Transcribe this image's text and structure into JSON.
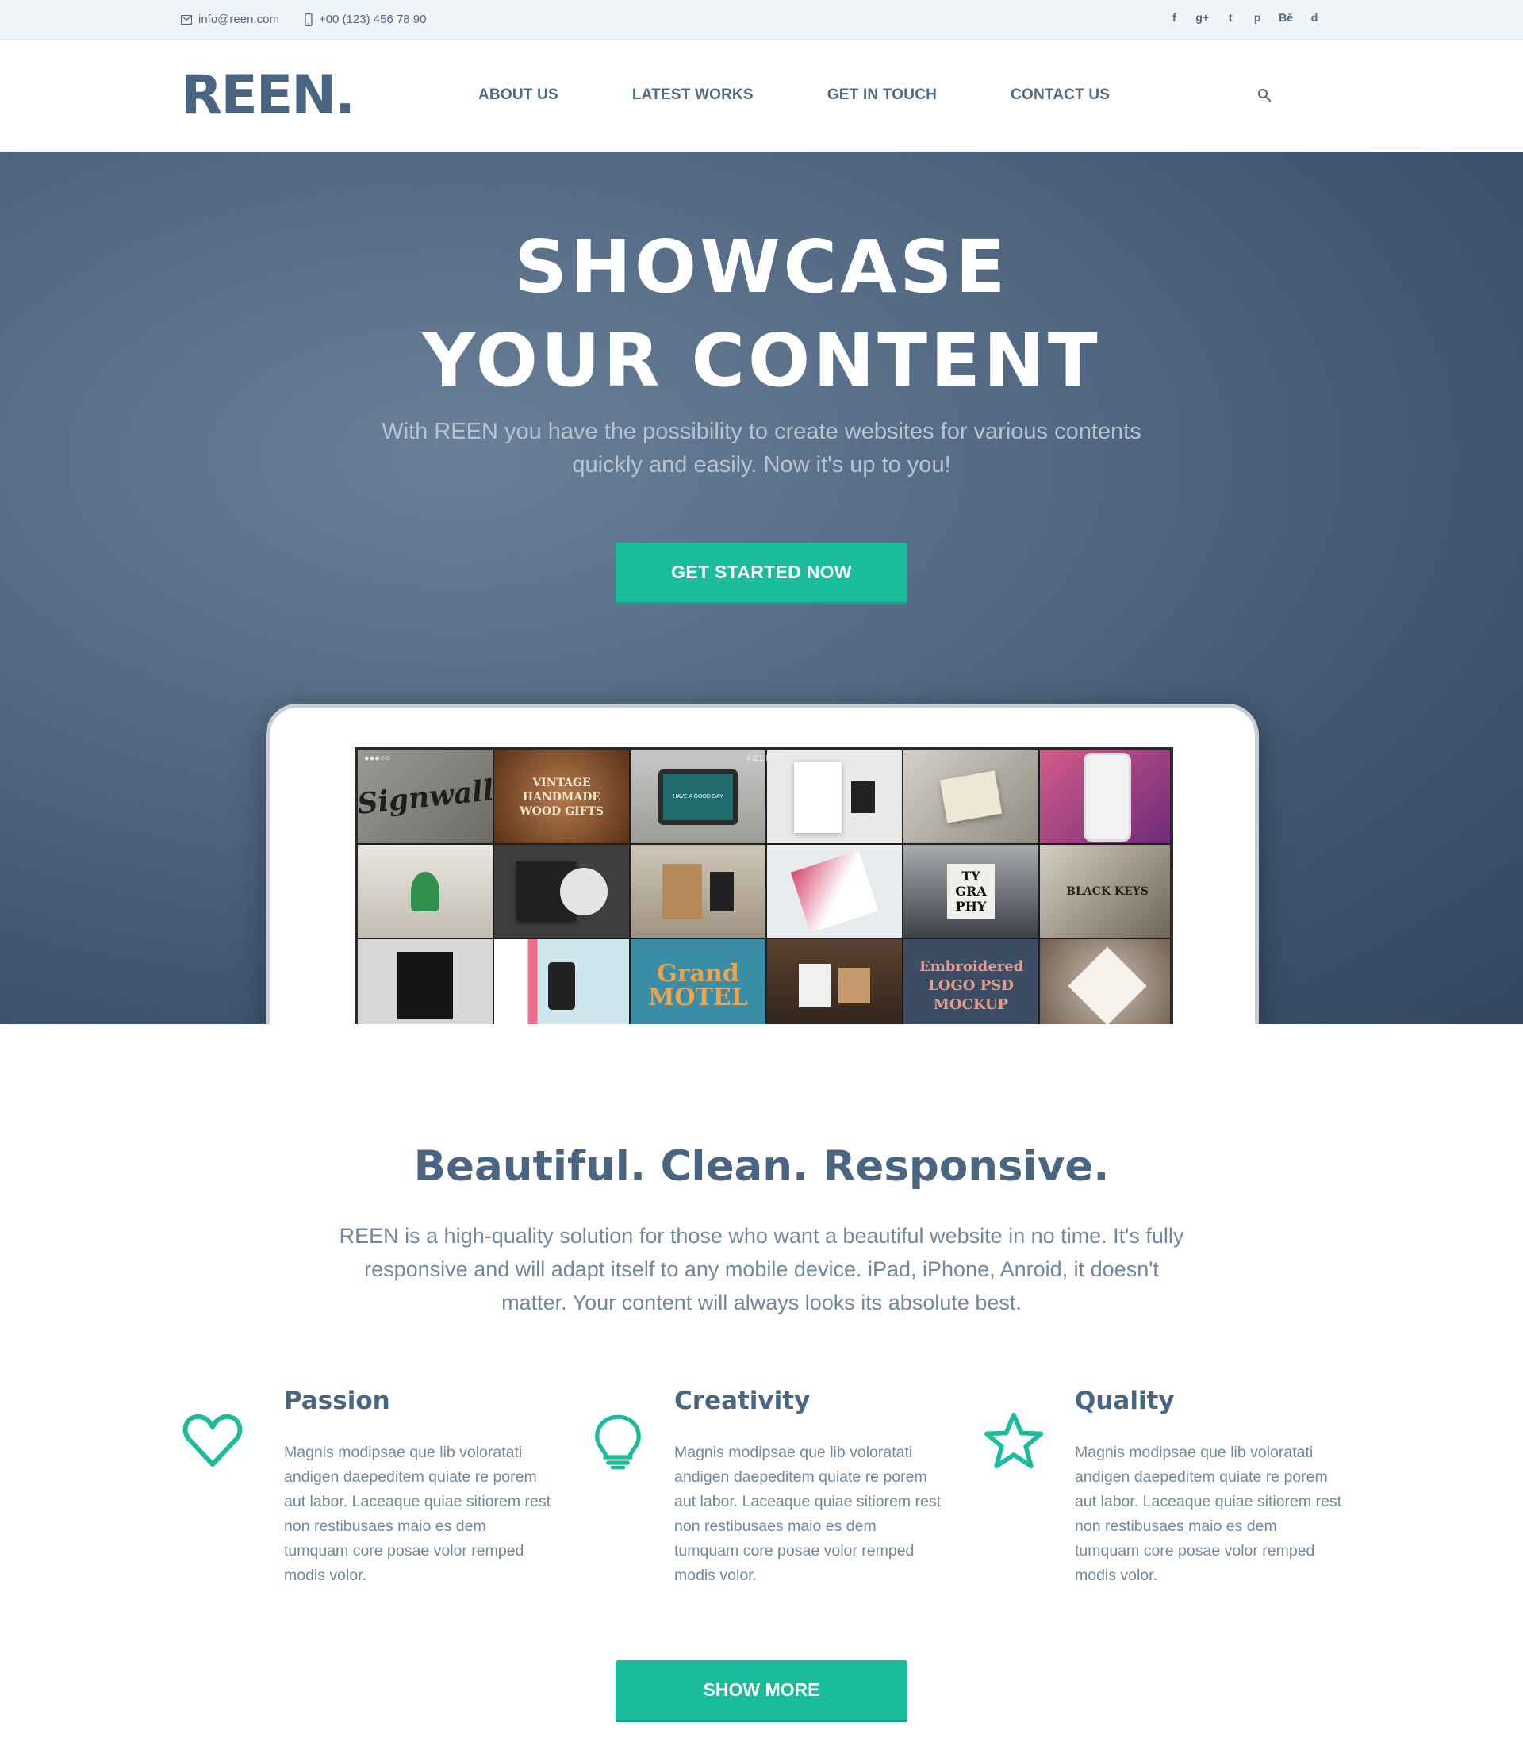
{
  "topbar": {
    "email": "info@reen.com",
    "phone": "+00 (123) 456 78 90",
    "social": [
      "f",
      "g+",
      "t",
      "p",
      "Bē",
      "d"
    ]
  },
  "nav": {
    "logo": "REEN.",
    "links": [
      "ABOUT US",
      "LATEST WORKS",
      "GET IN TOUCH",
      "CONTACT US"
    ]
  },
  "hero": {
    "title_line1": "SHOWCASE",
    "title_line2": "YOUR CONTENT",
    "subtitle": "With REEN you have the possibility to create websites for various contents quickly and easily. Now it's up to you!",
    "cta": "GET STARTED NOW",
    "device_clock": "4:21 PM",
    "tiles": [
      "Signwall",
      "VINTAGE HANDMADE WOOD GIFTS",
      "HAVE A GOOD DAY",
      "",
      "",
      "",
      "",
      "",
      "",
      "",
      "TY GRA PHY",
      "",
      "BLACK KEYS",
      "",
      "",
      "Grand MOTEL",
      "",
      "Embroidered LOGO PSD MOCKUP",
      ""
    ]
  },
  "features": {
    "title": "Beautiful. Clean. Responsive.",
    "text": "REEN is a high-quality solution for those who want a beautiful website in no time. It's fully responsive and will adapt itself to any mobile device. iPad, iPhone, Anroid, it doesn't matter. Your content will always looks its absolute best.",
    "items": [
      {
        "title": "Passion",
        "icon": "heart-icon",
        "text": "Magnis modipsae que lib voloratati andigen daepeditem quiate re porem aut labor. Laceaque quiae sitiorem rest non restibusaes maio es dem tumquam core posae volor remped modis volor."
      },
      {
        "title": "Creativity",
        "icon": "lightbulb-icon",
        "text": "Magnis modipsae que lib voloratati andigen daepeditem quiate re porem aut labor. Laceaque quiae sitiorem rest non restibusaes maio es dem tumquam core posae volor remped modis volor."
      },
      {
        "title": "Quality",
        "icon": "star-icon",
        "text": "Magnis modipsae que lib voloratati andigen daepeditem quiate re porem aut labor. Laceaque quiae sitiorem rest non restibusaes maio es dem tumquam core posae volor remped modis volor."
      }
    ],
    "more": "SHOW MORE"
  },
  "colors": {
    "accent": "#1abc9c",
    "brand": "#4a6582",
    "text": "#73879c"
  }
}
